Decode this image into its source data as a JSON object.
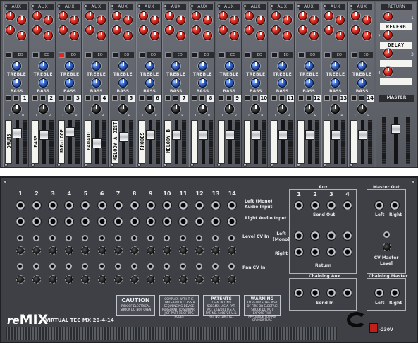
{
  "front": {
    "aux_header": "AUX",
    "return_header": "RETURN",
    "eq_label": "EQ",
    "treble_label": "TREBLE",
    "bass_label": "BASS",
    "mute_label": "M",
    "solo_label": "S",
    "pan_l": "L",
    "pan_r": "R",
    "channels": [
      {
        "num": "1",
        "label": "DRUMS",
        "eq_on": false,
        "fader": 0.25
      },
      {
        "num": "2",
        "label": "BASS",
        "eq_on": false,
        "fader": 0.3
      },
      {
        "num": "3",
        "label": "RNB-LOOP",
        "eq_on": true,
        "fader": 0.2
      },
      {
        "num": "4",
        "label": "BADAID",
        "eq_on": false,
        "fader": 0.55
      },
      {
        "num": "5",
        "label": "MELODY A DIST",
        "eq_on": false,
        "fader": 0.35
      },
      {
        "num": "6",
        "label": "RHODES",
        "eq_on": false,
        "fader": 0.3
      },
      {
        "num": "7",
        "label": "MELODY B",
        "eq_on": false,
        "fader": 0.3
      },
      {
        "num": "8",
        "label": "",
        "eq_on": false,
        "fader": 0.3
      },
      {
        "num": "9",
        "label": "",
        "eq_on": false,
        "fader": 0.3
      },
      {
        "num": "10",
        "label": "",
        "eq_on": false,
        "fader": 0.3
      },
      {
        "num": "11",
        "label": "",
        "eq_on": false,
        "fader": 0.3
      },
      {
        "num": "12",
        "label": "",
        "eq_on": false,
        "fader": 0.3
      },
      {
        "num": "13",
        "label": "",
        "eq_on": false,
        "fader": 0.3
      },
      {
        "num": "14",
        "label": "",
        "eq_on": false,
        "fader": 0.3
      }
    ],
    "returns": [
      {
        "num": "1",
        "label": "REVERB"
      },
      {
        "num": "2",
        "label": "DELAY"
      },
      {
        "num": "3",
        "label": ""
      },
      {
        "num": "4",
        "label": ""
      }
    ],
    "master_label": "MASTER",
    "master_fader": 0.2
  },
  "back": {
    "channel_numbers": [
      "1",
      "2",
      "3",
      "4",
      "5",
      "6",
      "7",
      "8",
      "9",
      "10",
      "11",
      "12",
      "13",
      "14"
    ],
    "left_audio_input": "Left (Mono) Audio Input",
    "right_audio_input": "Right Audio Input",
    "level_cv_in": "Level CV In",
    "pan_cv_in": "Pan CV In",
    "aux_title": "Aux",
    "aux_numbers": [
      "1",
      "2",
      "3",
      "4"
    ],
    "send_out": "Send Out",
    "return_left": "Left (Mono)",
    "return_right": "Right",
    "return_label": "Return",
    "chaining_aux": "Chaining Aux",
    "send_in": "Send In",
    "master_out": "Master Out",
    "left": "Left",
    "right": "Right",
    "cv_master_level": "CV Master Level",
    "chaining_master": "Chaining Master",
    "caution_title": "CAUTION",
    "caution_text": "RISK OF ELECTRICAL SHOCK DO NOT OPEN",
    "complies_text": "COMPLIES WITH THE LIMITS FOR A CLASS A SEQUENCING DEVICE PURSUANT TO SUBPART J OF PART 15 OF RPS RULES",
    "patents_title": "PATENTS",
    "patents_text": "U.S.A. PAT. NO. 5333455 U.S.A. PAT. NO. 5332081 U.S.A. PAT. NO. 5466725 U.K. PAT. NO. 1944711",
    "warning_title": "WARNING",
    "warning_text": "TO REDUCE THE RISK OF FIRE OR ELECTRIC SHOCK DO NOT EXPOSE THIS APPLIANCE TO RAIN OR MOISTURE",
    "logo_re": "re",
    "logo_mix": "MIX",
    "model": "VIRTUAL TEC MX 20-4-14",
    "voltage": "-230V"
  }
}
